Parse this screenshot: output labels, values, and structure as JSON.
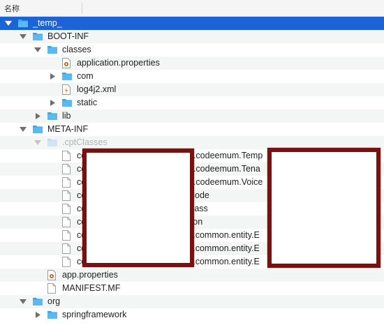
{
  "header": {
    "name_column": "名称"
  },
  "rows": [
    {
      "label": "_temp_",
      "kind": "folder",
      "disclosure": "down",
      "indent": 0,
      "selected": true
    },
    {
      "label": "BOOT-INF",
      "kind": "folder",
      "disclosure": "down",
      "indent": 1
    },
    {
      "label": "classes",
      "kind": "folder",
      "disclosure": "down",
      "indent": 2
    },
    {
      "label": "application.properties",
      "kind": "properties-file",
      "disclosure": "",
      "indent": 3
    },
    {
      "label": "com",
      "kind": "folder",
      "disclosure": "right",
      "indent": 3
    },
    {
      "label": "log4j2.xml",
      "kind": "xml-file",
      "disclosure": "",
      "indent": 3
    },
    {
      "label": "static",
      "kind": "folder",
      "disclosure": "right",
      "indent": 3
    },
    {
      "label": "lib",
      "kind": "folder",
      "disclosure": "right",
      "indent": 2
    },
    {
      "label": "META-INF",
      "kind": "folder",
      "disclosure": "down",
      "indent": 1
    },
    {
      "label": ".cptClasses",
      "kind": "folder-dim",
      "disclosure": "down-dim",
      "indent": 2
    },
    {
      "label": "co",
      "kind": "file",
      "disclosure": "",
      "indent": 3,
      "tail": "n.codeemum.Temp"
    },
    {
      "label": "co",
      "kind": "file",
      "disclosure": "",
      "indent": 3,
      "tail": "n.codeemum.Tena"
    },
    {
      "label": "co",
      "kind": "file",
      "disclosure": "",
      "indent": 3,
      "tail": "n.codeemum.Voice"
    },
    {
      "label": "co",
      "kind": "file",
      "disclosure": "",
      "indent": 3,
      "tail": "Code"
    },
    {
      "label": "co",
      "kind": "file",
      "disclosure": "",
      "indent": 3,
      "tail": "Pass"
    },
    {
      "label": "co",
      "kind": "file",
      "disclosure": "",
      "indent": 3,
      "tail": "tion"
    },
    {
      "label": "co",
      "kind": "file",
      "disclosure": "",
      "indent": 3,
      "tail": "s.common.entity.E"
    },
    {
      "label": "co",
      "kind": "file",
      "disclosure": "",
      "indent": 3,
      "tail": "s.common.entity.E"
    },
    {
      "label": "co",
      "kind": "file",
      "disclosure": "",
      "indent": 3,
      "tail": "s.common.entity.E"
    },
    {
      "label": "app.properties",
      "kind": "properties-file",
      "disclosure": "",
      "indent": 2
    },
    {
      "label": "MANIFEST.MF",
      "kind": "file",
      "disclosure": "",
      "indent": 2
    },
    {
      "label": "org",
      "kind": "folder",
      "disclosure": "down",
      "indent": 1
    },
    {
      "label": "springframework",
      "kind": "folder",
      "disclosure": "right",
      "indent": 2
    }
  ],
  "colors": {
    "selection": "#1b63d6",
    "folder": "#5bb9f0",
    "redaction": "#7a1111"
  }
}
